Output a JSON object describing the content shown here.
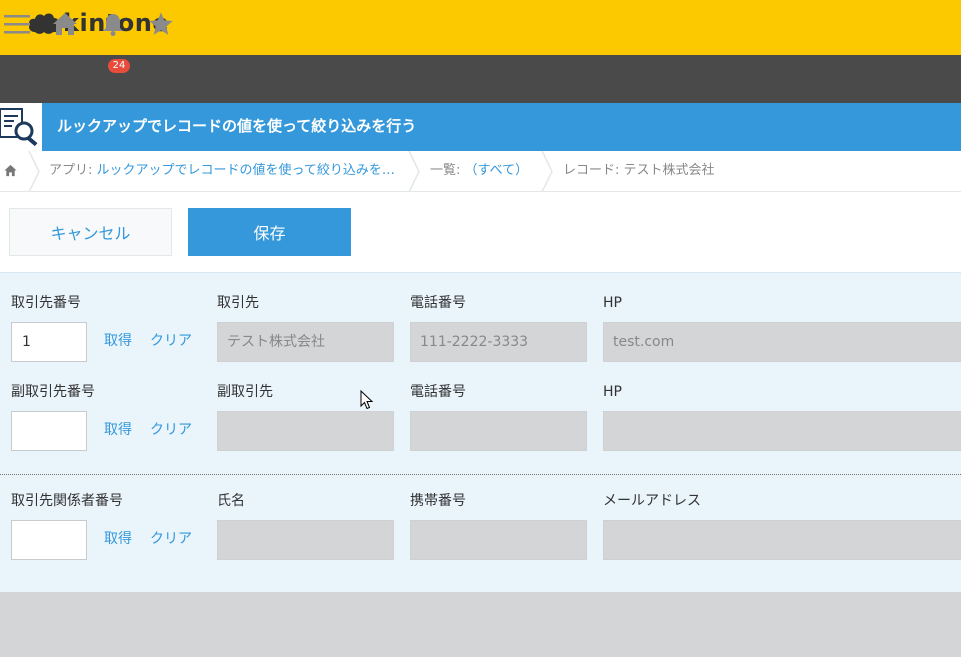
{
  "brand": {
    "name": "kintone"
  },
  "nav": {
    "notification_count": "24"
  },
  "app": {
    "title": "ルックアップでレコードの値を使って絞り込みを行う"
  },
  "breadcrumb": {
    "app_prefix": "アプリ: ",
    "app_name": "ルックアップでレコードの値を使って絞り込みを…",
    "list_prefix": "一覧: ",
    "list_name": "（すべて）",
    "record": "レコード: テスト株式会社"
  },
  "toolbar": {
    "cancel_label": "キャンセル",
    "save_label": "保存"
  },
  "actions": {
    "fetch": "取得",
    "clear": "クリア"
  },
  "rows": [
    {
      "lookup_label": "取引先番号",
      "lookup_value": "1",
      "f1_label": "取引先",
      "f1_value": "テスト株式会社",
      "f2_label": "電話番号",
      "f2_value": "111-2222-3333",
      "f3_label": "HP",
      "f3_value": "test.com"
    },
    {
      "lookup_label": "副取引先番号",
      "lookup_value": "",
      "f1_label": "副取引先",
      "f1_value": "",
      "f2_label": "電話番号",
      "f2_value": "",
      "f3_label": "HP",
      "f3_value": ""
    },
    {
      "lookup_label": "取引先関係者番号",
      "lookup_value": "",
      "f1_label": "氏名",
      "f1_value": "",
      "f2_label": "携帯番号",
      "f2_value": "",
      "f3_label": "メールアドレス",
      "f3_value": ""
    }
  ],
  "icons": {
    "logo": "cloud-logo-icon",
    "menu": "hamburger-menu-icon",
    "home": "home-icon",
    "notifications": "bell-icon",
    "favorites": "star-icon",
    "app": "search-document-icon",
    "breadcrumb_home": "home-icon"
  },
  "colors": {
    "header": "#fcc800",
    "nav": "#4a4a4a",
    "accent": "#3498db",
    "form_bg": "#e9f4fb",
    "readonly_bg": "#d4d5d6",
    "badge": "#e74c3c"
  }
}
